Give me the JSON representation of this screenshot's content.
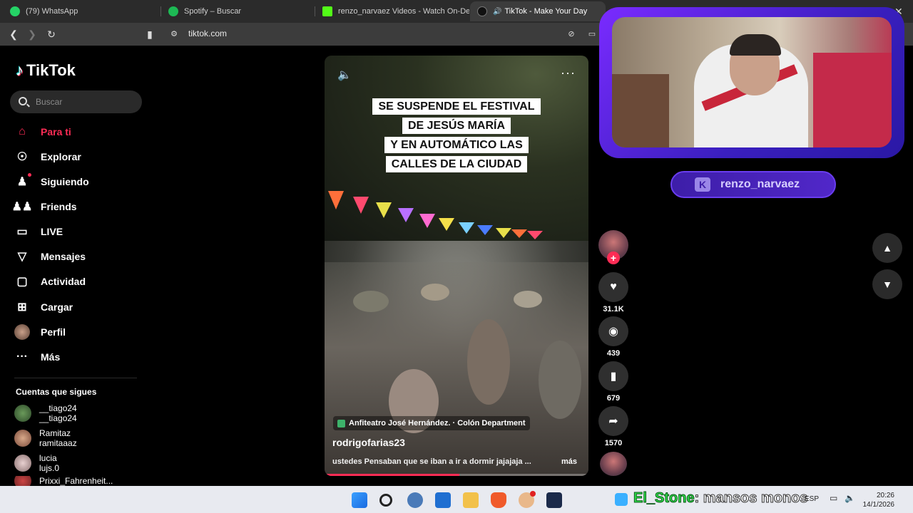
{
  "browser": {
    "tabs": [
      {
        "title": "(79) WhatsApp",
        "color": "#25d366"
      },
      {
        "title": "Spotify – Buscar",
        "color": "#1db954"
      },
      {
        "title": "renzo_narvaez Videos - Watch On-De",
        "color": "#53fc18"
      },
      {
        "title": "TikTok - Make Your Day",
        "color": "#111111"
      }
    ],
    "url": "tiktok.com"
  },
  "sidebar": {
    "logo": "TikTok",
    "search_placeholder": "Buscar",
    "menu": [
      {
        "label": "Para ti",
        "icon": "home-icon"
      },
      {
        "label": "Explorar",
        "icon": "compass-icon"
      },
      {
        "label": "Siguiendo",
        "icon": "user-follow-icon"
      },
      {
        "label": "Friends",
        "icon": "friends-icon"
      },
      {
        "label": "LIVE",
        "icon": "live-tv-icon"
      },
      {
        "label": "Mensajes",
        "icon": "send-icon"
      },
      {
        "label": "Actividad",
        "icon": "activity-icon"
      },
      {
        "label": "Cargar",
        "icon": "upload-icon"
      },
      {
        "label": "Perfil",
        "icon": "profile-avatar"
      },
      {
        "label": "Más",
        "icon": "more-dots-icon"
      }
    ],
    "following_title": "Cuentas que sigues",
    "following": [
      {
        "name": "__tiago24",
        "handle": "__tiago24"
      },
      {
        "name": "Ramitaz",
        "handle": "ramitaaaz"
      },
      {
        "name": "lucia",
        "handle": "lujs.0"
      },
      {
        "name": "Prixxi_Fahrenheit...",
        "handle": ""
      }
    ]
  },
  "video": {
    "caption_lines": [
      "SE SUSPENDE EL FESTIVAL",
      "DE JESÚS MARÍA",
      "Y EN AUTOMÁTICO LAS",
      "CALLES DE LA CIUDAD"
    ],
    "location": "Anfiteatro José Hernández. · Colón Department",
    "author": "rodrigofarias23",
    "description": "ustedes Pensaban que se iban a ir a dormir jajajaja ...",
    "more_label": "más",
    "progress": 0.51
  },
  "actions": {
    "likes": "31.1K",
    "comments": "439",
    "saves": "679",
    "shares": "1570"
  },
  "stream": {
    "channel": "renzo_narvaez",
    "ticker_user": "El_Stone",
    "ticker_msg": ": mansos monos"
  },
  "taskbar": {
    "time": "20:26",
    "date": "14/1/2026",
    "lang": "ESP"
  }
}
